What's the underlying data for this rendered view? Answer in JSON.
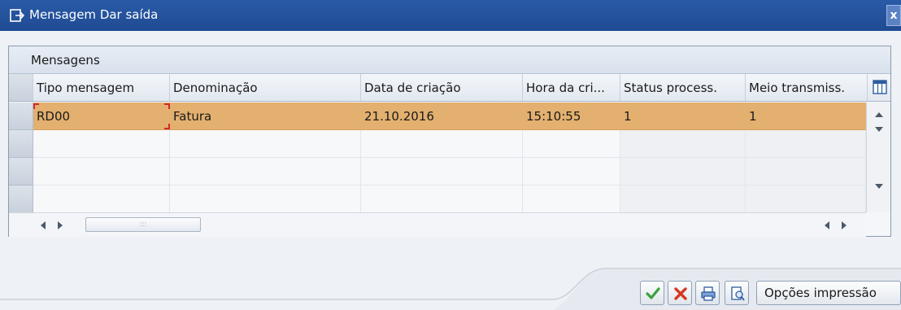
{
  "window": {
    "title": "Mensagem Dar saída",
    "close_label": "x"
  },
  "grid": {
    "title": "Mensagens",
    "columns": [
      {
        "label": "Tipo mensagem"
      },
      {
        "label": "Denominação"
      },
      {
        "label": "Data de criação"
      },
      {
        "label": "Hora da cri..."
      },
      {
        "label": "Status process."
      },
      {
        "label": "Meio transmiss."
      }
    ],
    "rows": [
      {
        "selected": true,
        "cells": [
          "RD00",
          "Fatura",
          "21.10.2016",
          "15:10:55",
          "1",
          "1"
        ]
      },
      {
        "selected": false,
        "cells": [
          "",
          "",
          "",
          "",
          "",
          ""
        ]
      },
      {
        "selected": false,
        "cells": [
          "",
          "",
          "",
          "",
          "",
          ""
        ]
      },
      {
        "selected": false,
        "cells": [
          "",
          "",
          "",
          "",
          "",
          ""
        ]
      }
    ],
    "hscroll_thumb_grip": ":::"
  },
  "toolbar": {
    "ok_icon": "check-icon",
    "cancel_icon": "cancel-icon",
    "print_icon": "printer-icon",
    "preview_icon": "print-preview-icon",
    "print_options_label": "Opções impressão"
  },
  "colors": {
    "titlebar": "#1f4b93",
    "selected_row": "#e3b06f",
    "ok_green": "#3aa33a",
    "cancel_red": "#d63a20"
  }
}
